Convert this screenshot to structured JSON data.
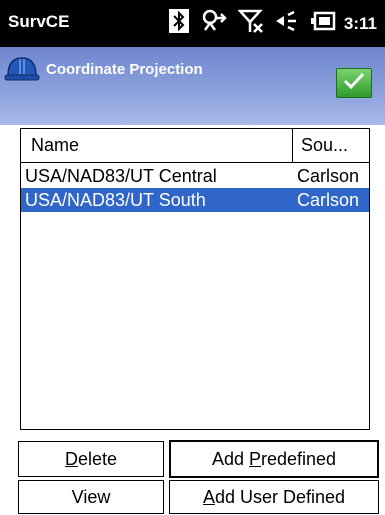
{
  "status_bar": {
    "app_name": "SurvCE",
    "time": "3:11"
  },
  "title_bar": {
    "title": "Coordinate Projection",
    "ok_label": ""
  },
  "list": {
    "columns": [
      "Name",
      "Sou..."
    ],
    "rows": [
      {
        "name": "USA/NAD83/UT Central",
        "source": "Carlson",
        "selected": false
      },
      {
        "name": "USA/NAD83/UT South",
        "source": "Carlson",
        "selected": true
      }
    ]
  },
  "buttons": {
    "delete": {
      "pre": "",
      "key": "D",
      "post": "elete"
    },
    "add_predefined": {
      "pre": "Add ",
      "key": "P",
      "post": "redefined"
    },
    "view": {
      "pre": "",
      "key": "",
      "post": "View"
    },
    "add_user_defined": {
      "pre": "",
      "key": "A",
      "post": "dd User Defined"
    }
  },
  "colors": {
    "selection": "#2f66c8",
    "title_gradient_top": "#6f86cf",
    "ok_green": "#2f9b2a"
  }
}
